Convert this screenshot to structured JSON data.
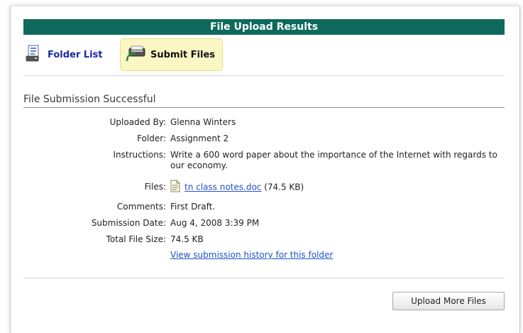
{
  "header": {
    "title": "File Upload Results"
  },
  "toolbar": {
    "folder_list": {
      "label": "Folder List",
      "icon": "folder-list-icon"
    },
    "submit_files": {
      "label": "Submit Files",
      "icon": "submit-files-icon"
    }
  },
  "section": {
    "title": "File Submission Successful"
  },
  "details": {
    "uploaded_by": {
      "label": "Uploaded By:",
      "value": "Glenna Winters"
    },
    "folder": {
      "label": "Folder:",
      "value": "Assignment 2"
    },
    "instructions": {
      "label": "Instructions:",
      "value": "Write a 600 word paper about the importance of the Internet with regards to our economy."
    },
    "files": {
      "label": "Files:",
      "file_name": "tn class notes.doc",
      "file_size": "(74.5 KB)",
      "icon": "document-icon"
    },
    "comments": {
      "label": "Comments:",
      "value": "First Draft."
    },
    "submission_date": {
      "label": "Submission Date:",
      "value": "Aug 4, 2008 3:39 PM"
    },
    "total_size": {
      "label": "Total File Size:",
      "value": "74.5 KB"
    },
    "history_link": "View submission history for this folder"
  },
  "footer": {
    "upload_more_label": "Upload More Files"
  },
  "colors": {
    "title_bar": "#0d6a5c",
    "link": "#2050c8",
    "highlight": "#fbf7c5"
  }
}
